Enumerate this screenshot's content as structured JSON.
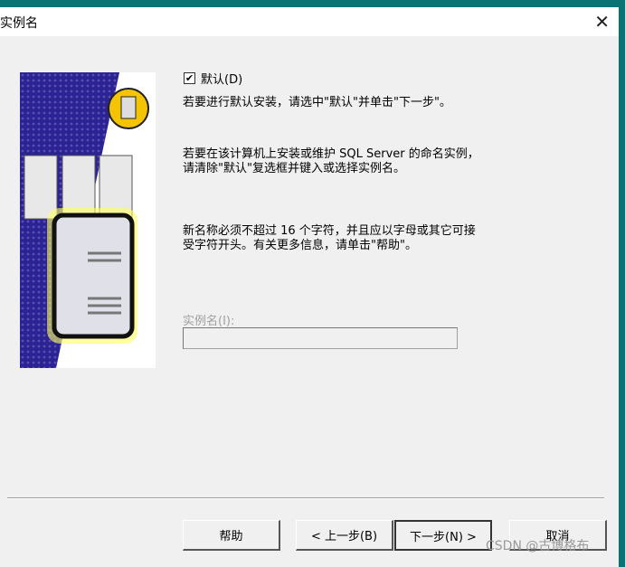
{
  "window": {
    "title": "实例名",
    "close_icon": "close-icon"
  },
  "checkbox": {
    "label": "默认(D)",
    "checked": true
  },
  "paragraphs": [
    "若要进行默认安装，请选中\"默认\"并单击\"下一步\"。",
    "若要在该计算机上安装或维护 SQL Server 的命名实例，请清除\"默认\"复选框并键入或选择实例名。",
    "新名称必须不超过 16 个字符，并且应以字母或其它可接受字符开头。有关更多信息，请单击\"帮助\"。"
  ],
  "instance": {
    "label": "实例名(I):",
    "value": ""
  },
  "buttons": {
    "help": "帮助",
    "back": "< 上一步(B)",
    "next": "下一步(N) >",
    "cancel": "取消"
  },
  "watermark": "CSDN @古博格布"
}
